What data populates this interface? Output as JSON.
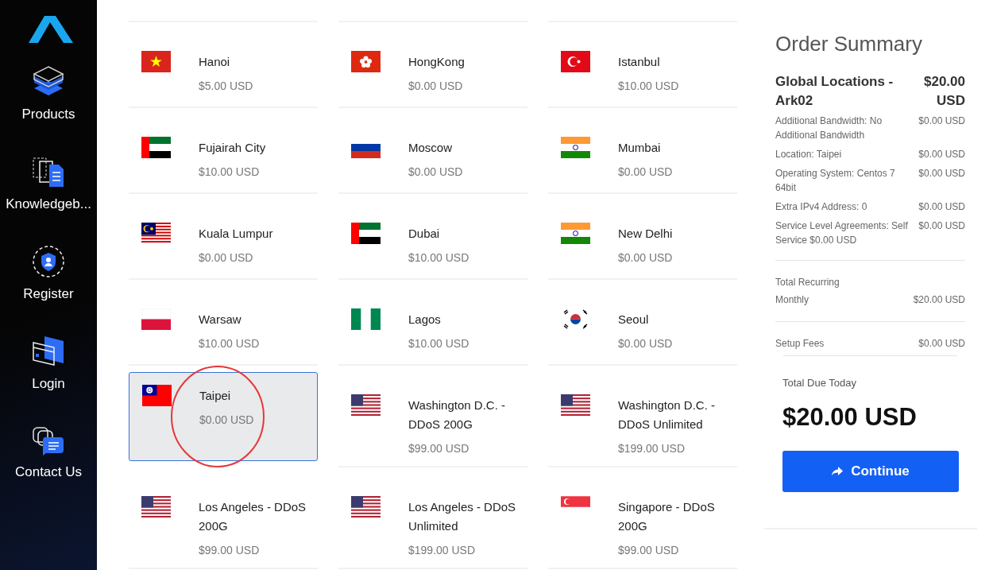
{
  "sidebar": {
    "items": [
      {
        "label": "Products",
        "kind": "server"
      },
      {
        "label": "Knowledgeb...",
        "kind": "docs"
      },
      {
        "label": "Register",
        "kind": "user"
      },
      {
        "label": "Login",
        "kind": "card"
      },
      {
        "label": "Contact Us",
        "kind": "chat"
      }
    ]
  },
  "locations": [
    {
      "name": "Hanoi",
      "price": "$5.00 USD",
      "kind": "vn",
      "selected": false
    },
    {
      "name": "HongKong",
      "price": "$0.00 USD",
      "kind": "hk",
      "selected": false
    },
    {
      "name": "Istanbul",
      "price": "$10.00 USD",
      "kind": "tr",
      "selected": false
    },
    {
      "name": "Fujairah City",
      "price": "$10.00 USD",
      "kind": "ae",
      "selected": false
    },
    {
      "name": "Moscow",
      "price": "$0.00 USD",
      "kind": "ru",
      "selected": false
    },
    {
      "name": "Mumbai",
      "price": "$0.00 USD",
      "kind": "in",
      "selected": false
    },
    {
      "name": "Kuala Lumpur",
      "price": "$0.00 USD",
      "kind": "my",
      "selected": false
    },
    {
      "name": "Dubai",
      "price": "$10.00 USD",
      "kind": "ae",
      "selected": false
    },
    {
      "name": "New Delhi",
      "price": "$0.00 USD",
      "kind": "in",
      "selected": false
    },
    {
      "name": "Warsaw",
      "price": "$10.00 USD",
      "kind": "pl",
      "selected": false
    },
    {
      "name": "Lagos",
      "price": "$10.00 USD",
      "kind": "ng",
      "selected": false
    },
    {
      "name": "Seoul",
      "price": "$0.00 USD",
      "kind": "kr",
      "selected": false
    },
    {
      "name": "Taipei",
      "price": "$0.00 USD",
      "kind": "tw",
      "selected": true
    },
    {
      "name": "Washington D.C. - DDoS 200G",
      "price": "$99.00 USD",
      "kind": "us",
      "selected": false
    },
    {
      "name": "Washington D.C. - DDoS Unlimited",
      "price": "$199.00 USD",
      "kind": "us",
      "selected": false
    },
    {
      "name": "Los Angeles - DDoS 200G",
      "price": "$99.00 USD",
      "kind": "us",
      "selected": false
    },
    {
      "name": "Los Angeles - DDoS Unlimited",
      "price": "$199.00 USD",
      "kind": "us",
      "selected": false
    },
    {
      "name": "Singapore - DDoS 200G",
      "price": "$99.00 USD",
      "kind": "sg",
      "selected": false
    }
  ],
  "summary": {
    "title": "Order Summary",
    "product": "Global Locations - Ark02",
    "product_price": "$20.00 USD",
    "lines": [
      {
        "label": "Additional Bandwidth: No Additional Bandwidth",
        "price": "$0.00 USD"
      },
      {
        "label": "Location: Taipei",
        "price": "$0.00 USD"
      },
      {
        "label": "Operating System: Centos 7 64bit",
        "price": "$0.00 USD"
      },
      {
        "label": "Extra IPv4 Address: 0",
        "price": "$0.00 USD"
      },
      {
        "label": "Service Level Agreements: Self Service $0.00 USD",
        "price": "$0.00 USD"
      }
    ],
    "recurring_title": "Total Recurring",
    "recurring_label": "Monthly",
    "recurring_price": "$20.00 USD",
    "setup_label": "Setup Fees",
    "setup_price": "$0.00 USD",
    "due_label": "Total Due Today",
    "due_amount": "$20.00 USD",
    "button": "Continue"
  }
}
